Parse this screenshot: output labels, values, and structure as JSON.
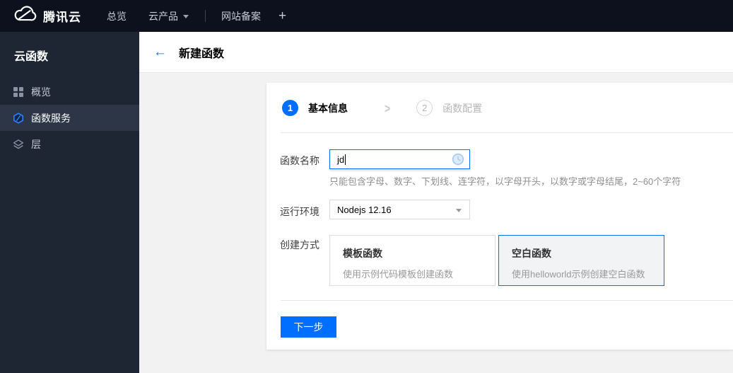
{
  "topnav": {
    "brand": "腾讯云",
    "overview": "总览",
    "products": "云产品",
    "beian": "网站备案",
    "plus": "+"
  },
  "sidebar": {
    "title": "云函数",
    "items": [
      {
        "label": "概览",
        "icon": "grid-icon",
        "selected": false
      },
      {
        "label": "函数服务",
        "icon": "function-hexagon-icon",
        "selected": true
      },
      {
        "label": "层",
        "icon": "layers-icon",
        "selected": false
      }
    ]
  },
  "header": {
    "back": "←",
    "title": "新建函数"
  },
  "wizard": {
    "chevron": ">",
    "steps": [
      {
        "num": "1",
        "label": "基本信息",
        "active": true
      },
      {
        "num": "2",
        "label": "函数配置",
        "active": false
      }
    ]
  },
  "form": {
    "name_label": "函数名称",
    "name_value": "jd",
    "name_help": "只能包含字母、数字、下划线、连字符，以字母开头，以数字或字母结尾，2~60个字符",
    "runtime_label": "运行环境",
    "runtime_value": "Nodejs 12.16",
    "method_label": "创建方式",
    "methods": [
      {
        "title": "模板函数",
        "desc": "使用示例代码模板创建函数",
        "selected": false
      },
      {
        "title": "空白函数",
        "desc": "使用helloworld示例创建空白函数",
        "selected": true
      }
    ],
    "next_label": "下一步"
  },
  "icons": {
    "logo": "tencent-cloud-logo-icon",
    "input_status": "clock-pending-icon",
    "select_arrow": "dropdown-caret-icon"
  },
  "colors": {
    "accent": "#006eff",
    "topnav_bg": "#0c111d",
    "sidebar_bg": "#1e2634",
    "sidebar_selected_bg": "#2d3647",
    "content_bg": "#f2f2f3",
    "border": "#e8e8e8"
  }
}
